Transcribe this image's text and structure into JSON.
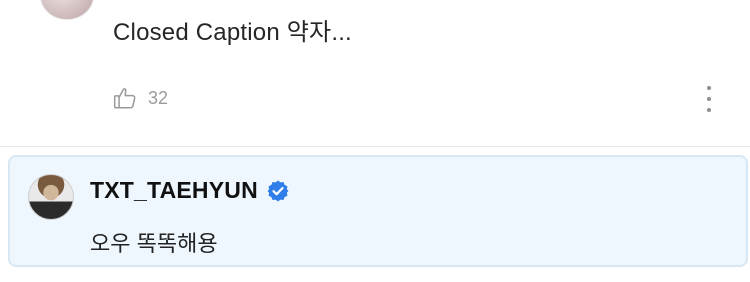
{
  "previous_comment": {
    "text": "Closed Caption 약자...",
    "like_icon": "thumbs-up-icon",
    "like_count": "32",
    "more_icon": "more-vertical-icon"
  },
  "reply": {
    "author": "TXT_TAEHYUN",
    "verified_icon": "verified-badge-icon",
    "text": "오우 똑똑해용"
  },
  "colors": {
    "highlight_bg": "#eef7fd",
    "highlight_border": "#d7e8f4",
    "verified_blue": "#2f7ee9",
    "muted": "#9a9a9a"
  }
}
